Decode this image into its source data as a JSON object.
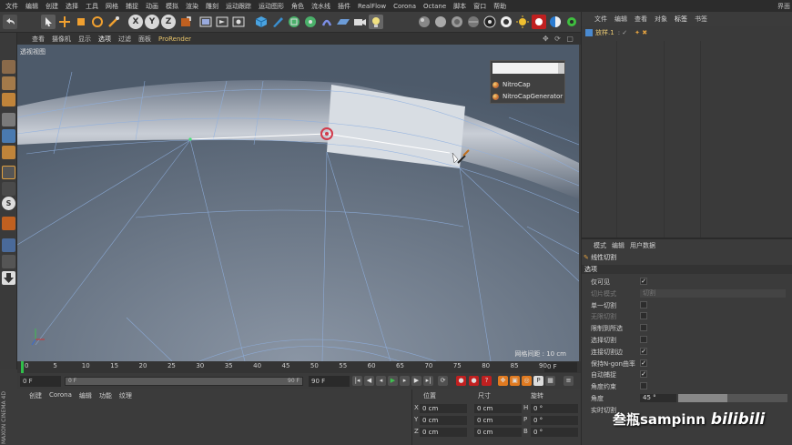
{
  "app": {
    "corner_label": "界面"
  },
  "menubar": {
    "items": [
      "文件",
      "编辑",
      "创建",
      "选择",
      "工具",
      "网格",
      "捕捉",
      "动画",
      "模拟",
      "渲染",
      "雕刻",
      "运动跟踪",
      "运动图形",
      "角色",
      "流水线",
      "插件",
      "RealFlow",
      "Corona",
      "Octane",
      "脚本",
      "窗口",
      "帮助"
    ]
  },
  "toolbar": {
    "icons": [
      "undo-icon",
      "select-arrow-icon",
      "move-icon",
      "scale-icon",
      "rotate-icon",
      "brush-icon",
      "x-axis-icon",
      "y-axis-icon",
      "z-axis-icon",
      "coordinate-icon",
      "render-view-icon",
      "render-picture-icon",
      "render-settings-icon",
      "cube-icon",
      "pen-icon",
      "subdivision-icon",
      "array-icon",
      "deformer-icon",
      "floor-icon",
      "camera-icon",
      "light-icon"
    ],
    "axis_labels": [
      "X",
      "Y",
      "Z"
    ],
    "right_icons": [
      "octane-sphere-icon",
      "octane-material-icon",
      "octane-mix-icon",
      "octane-texture-icon",
      "octane-settings-icon",
      "octane-target-icon",
      "sun-icon",
      "octane-live-icon",
      "octane-half-icon",
      "octane-light-icon",
      "gear-green-icon"
    ]
  },
  "viewport_menu": {
    "items": [
      "查看",
      "摄像机",
      "显示",
      "选项",
      "过滤",
      "面板",
      "ProRender"
    ],
    "active_index": 3
  },
  "viewport": {
    "label": "透视视图",
    "grid_spacing": "网格间距 : 10 cm"
  },
  "popup": {
    "search_value": "",
    "items": [
      "NitroCap",
      "NitroCapGenerator"
    ]
  },
  "timeline": {
    "ticks": [
      "0",
      "5",
      "10",
      "15",
      "20",
      "25",
      "30",
      "35",
      "40",
      "45",
      "50",
      "55",
      "60",
      "65",
      "70",
      "75",
      "80",
      "85",
      "90"
    ],
    "current_frame": "0 F"
  },
  "transport": {
    "start": "0 F",
    "slider_start": "0 F",
    "slider_end": "90 F",
    "end": "90 F"
  },
  "bottom_menu": {
    "items": [
      "创建",
      "Corona",
      "编辑",
      "功能",
      "纹理"
    ]
  },
  "maxon": "MAXON CINEMA 4D",
  "coords": {
    "headers": [
      "位置",
      "尺寸",
      "旋转"
    ],
    "rows": [
      {
        "axis": "X",
        "pos": "0 cm",
        "size": "0 cm",
        "rot_axis": "H",
        "rot": "0 °"
      },
      {
        "axis": "Y",
        "pos": "0 cm",
        "size": "0 cm",
        "rot_axis": "P",
        "rot": "0 °"
      },
      {
        "axis": "Z",
        "pos": "0 cm",
        "size": "0 cm",
        "rot_axis": "B",
        "rot": "0 °"
      }
    ]
  },
  "object_manager": {
    "menu": [
      "文件",
      "编辑",
      "查看",
      "对象",
      "标签",
      "书签"
    ],
    "active_index": 4,
    "object_name": "放样.1"
  },
  "attributes": {
    "menu": [
      "模式",
      "编辑",
      "用户数据"
    ],
    "tool_name": "线性切割",
    "section": "选项",
    "options": [
      {
        "label": "仅可见",
        "type": "check",
        "checked": true,
        "dim": false
      },
      {
        "label": "切片模式",
        "type": "select",
        "value": "切割",
        "dim": true
      },
      {
        "label": "单一切割",
        "type": "check",
        "checked": false,
        "dim": false
      },
      {
        "label": "无限切割",
        "type": "check",
        "checked": false,
        "dim": true
      },
      {
        "label": "限制到所选",
        "type": "check",
        "checked": false,
        "dim": false
      },
      {
        "label": "选择切割",
        "type": "check",
        "checked": false,
        "dim": false
      },
      {
        "label": "连接切割边",
        "type": "check",
        "checked": true,
        "dim": false
      },
      {
        "label": "保持N-gon曲率",
        "type": "check",
        "checked": true,
        "dim": false
      },
      {
        "label": "自动捕捉",
        "type": "check",
        "checked": true,
        "dim": false
      },
      {
        "label": "角度约束",
        "type": "check",
        "checked": false,
        "dim": false
      },
      {
        "label": "角度",
        "type": "angle",
        "value": "45 °",
        "fill_fraction": 0.45,
        "dim": false
      },
      {
        "label": "实时切割",
        "type": "none",
        "dim": false
      }
    ]
  },
  "watermark": {
    "text": "叁瓶sampinn",
    "logo": "bilibili"
  },
  "colors": {
    "accent": "#e6c36a",
    "selection": "#d8dde3",
    "timeline_marker": "#2fbf4a",
    "cursor_ring": "#d23a4a"
  }
}
